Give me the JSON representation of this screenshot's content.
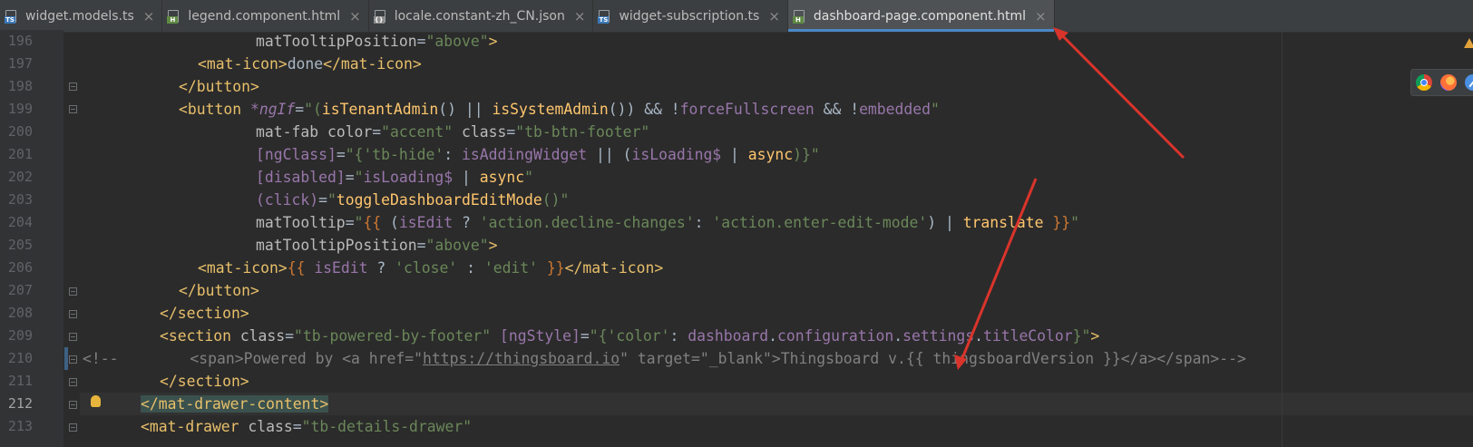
{
  "tabs": [
    {
      "label": "widget.models.ts",
      "icon": "typescript-file-icon",
      "badge": "TS",
      "active": false
    },
    {
      "label": "legend.component.html",
      "icon": "html-file-icon",
      "badge": "H",
      "active": false
    },
    {
      "label": "locale.constant-zh_CN.json",
      "icon": "json-file-icon",
      "badge": "{}",
      "active": false
    },
    {
      "label": "widget-subscription.ts",
      "icon": "typescript-file-icon",
      "badge": "TS",
      "active": false
    },
    {
      "label": "dashboard-page.component.html",
      "icon": "html-file-icon",
      "badge": "H",
      "active": true
    }
  ],
  "close_glyph": "×",
  "line_numbers": [
    "196",
    "197",
    "198",
    "199",
    "200",
    "201",
    "202",
    "203",
    "204",
    "205",
    "206",
    "207",
    "208",
    "209",
    "210",
    "211",
    "212",
    "213"
  ],
  "current_line": "212",
  "code": {
    "l196": [
      "matTooltipPosition",
      "=",
      "\"above\"",
      ">"
    ],
    "l197": [
      "<mat-icon>",
      "done",
      "</mat-icon>"
    ],
    "l198": [
      "</button>"
    ],
    "l199": [
      "<button ",
      "*ngIf",
      "=",
      "\"(",
      "isTenantAdmin",
      "() || ",
      "isSystemAdmin",
      "()) && !",
      "forceFullscreen",
      " && !",
      "embedded",
      "\""
    ],
    "l200": [
      "mat-fab ",
      "color",
      "=",
      "\"accent\"",
      " class",
      "=",
      "\"tb-btn-footer\""
    ],
    "l201": [
      "[ngClass]",
      "=",
      "\"{",
      "'tb-hide'",
      ": ",
      "isAddingWidget",
      " || (",
      "isLoading$",
      " | ",
      "async",
      ")}\""
    ],
    "l202": [
      "[disabled]",
      "=",
      "\"",
      "isLoading$",
      " | ",
      "async",
      "\""
    ],
    "l203": [
      "(click)",
      "=",
      "\"",
      "toggleDashboardEditMode",
      "()\""
    ],
    "l204": [
      "matTooltip",
      "=",
      "\"",
      "{{",
      " (",
      "isEdit",
      " ? ",
      "'action.decline-changes'",
      ": ",
      "'action.enter-edit-mode'",
      ") | ",
      "translate",
      " ",
      "}}",
      "\""
    ],
    "l205": [
      "matTooltipPosition",
      "=",
      "\"above\"",
      ">"
    ],
    "l206": [
      "<mat-icon>",
      "{{",
      " ",
      "isEdit",
      " ? ",
      "'close'",
      " : ",
      "'edit'",
      " ",
      "}}",
      "</mat-icon>"
    ],
    "l207": [
      "</button>"
    ],
    "l208": [
      "</section>"
    ],
    "l209": [
      "<section ",
      "class",
      "=",
      "\"tb-powered-by-footer\"",
      " ",
      "[ngStyle]",
      "=",
      "\"{",
      "'color'",
      ": ",
      "dashboard",
      ".",
      "configuration",
      ".",
      "settings",
      ".",
      "titleColor",
      "}\"",
      ">"
    ],
    "l210": [
      "<!--",
      "        <span>Powered by <a href=\"",
      "https://thingsboard.io",
      "\" target=\"_blank\">Thingsboard v.{{ thingsboardVersion }}</a></span>-->"
    ],
    "l211": [
      "</section>"
    ],
    "l212": [
      "</mat-drawer-content>"
    ],
    "l213": [
      "<mat-drawer ",
      "class",
      "=",
      "\"tb-details-drawer\""
    ]
  },
  "side_icons": [
    "warning-icon",
    "chrome-icon",
    "firefox-icon",
    "safari-icon"
  ],
  "annotation_color": "#d9342b"
}
